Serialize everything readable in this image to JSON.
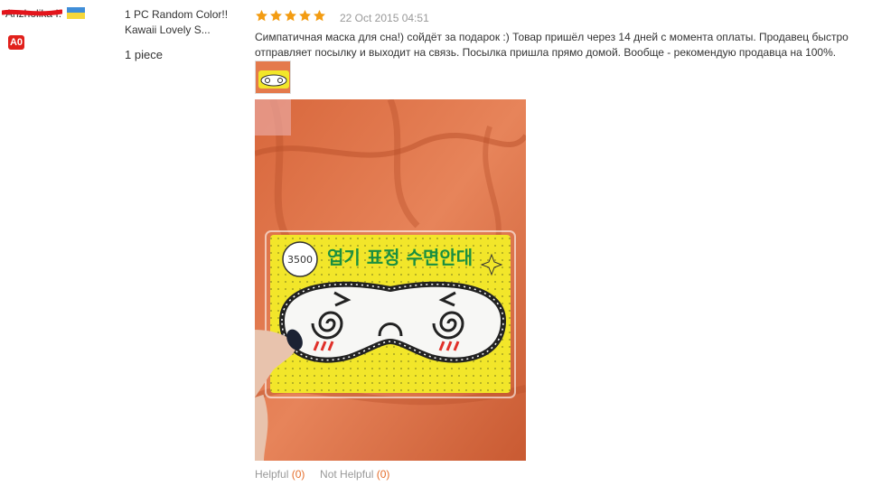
{
  "buyer": {
    "name": "Anzholika I.",
    "level": "A0",
    "flag_colors": [
      "#3f8ed8",
      "#f6d73a"
    ]
  },
  "product": {
    "name_line1": "1 PC Random Color!!",
    "name_line2": "Kawaii Lovely S...",
    "quantity": "1 piece"
  },
  "review": {
    "rating": 5,
    "date": "22 Oct 2015 04:51",
    "text": "Симпатичная маска для сна!) сойдёт за подарок :) Товар пришёл через 14 дней с момента оплаты. Продавец быстро отправляет посылку и выходит на связь. Посылка пришла прямо домой. Вообще - рекомендую продавца на 100%.",
    "package_price_text": "3500",
    "package_korean_text": "엽기 표정 수면안대"
  },
  "feedback": {
    "helpful_label": "Helpful",
    "helpful_count": "(0)",
    "not_helpful_label": "Not Helpful",
    "not_helpful_count": "(0)"
  },
  "colors": {
    "star": "#f39c12",
    "badge": "#e1201b",
    "count": "#e56d2a",
    "redaction": "#e3141b",
    "package_yellow": "#f2e62a",
    "blanket_orange": "#e47a4c"
  }
}
